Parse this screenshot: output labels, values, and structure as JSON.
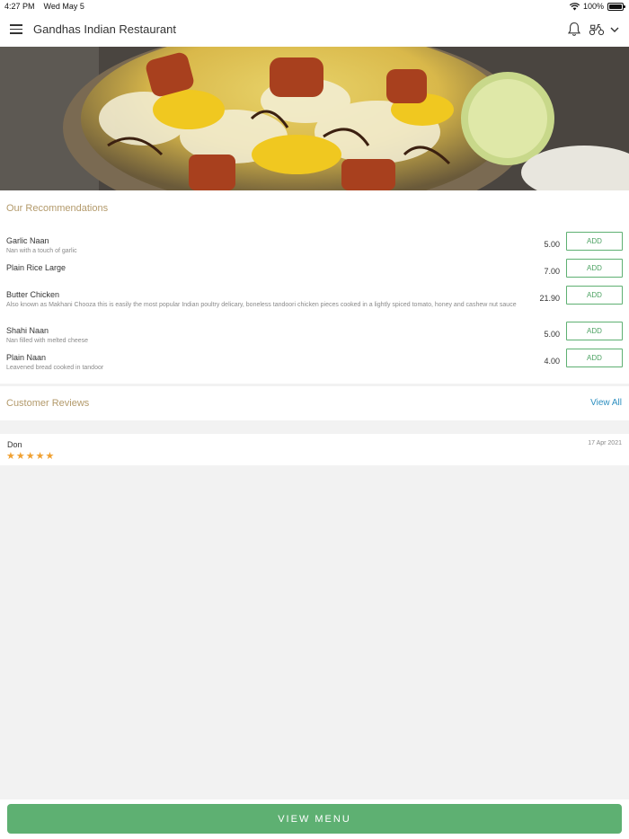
{
  "status_bar": {
    "time": "4:27 PM",
    "date": "Wed May 5",
    "battery": "100%"
  },
  "navbar": {
    "title": "Gandhas Indian Restaurant"
  },
  "recommendations": {
    "title": "Our Recommendations",
    "add_label": "ADD",
    "items": [
      {
        "name": "Garlic Naan",
        "description": "Nan with a touch of garlic",
        "price": "5.00"
      },
      {
        "name": "Plain Rice Large",
        "description": "",
        "price": "7.00"
      },
      {
        "name": "Butter Chicken",
        "description": "Also known as Makhani Chooza this is easily the most popular Indian poultry delicary, boneless tandoori chicken pieces cooked in a lightly spiced tomato, honey and cashew nut sauce",
        "price": "21.90"
      },
      {
        "name": "Shahi Naan",
        "description": "Nan filled with melted cheese",
        "price": "5.00"
      },
      {
        "name": "Plain Naan",
        "description": "Leavened bread cooked in tandoor",
        "price": "4.00"
      }
    ]
  },
  "reviews": {
    "title": "Customer Reviews",
    "view_all_label": "View All",
    "items": [
      {
        "name": "Don",
        "date": "17 Apr 2021",
        "rating": 5
      }
    ]
  },
  "footer": {
    "view_menu_label": "VIEW MENU"
  },
  "colors": {
    "accent_green": "#5eb072",
    "section_title": "#b39a6b",
    "link_blue": "#2d8fc0",
    "star": "#f0a030"
  }
}
